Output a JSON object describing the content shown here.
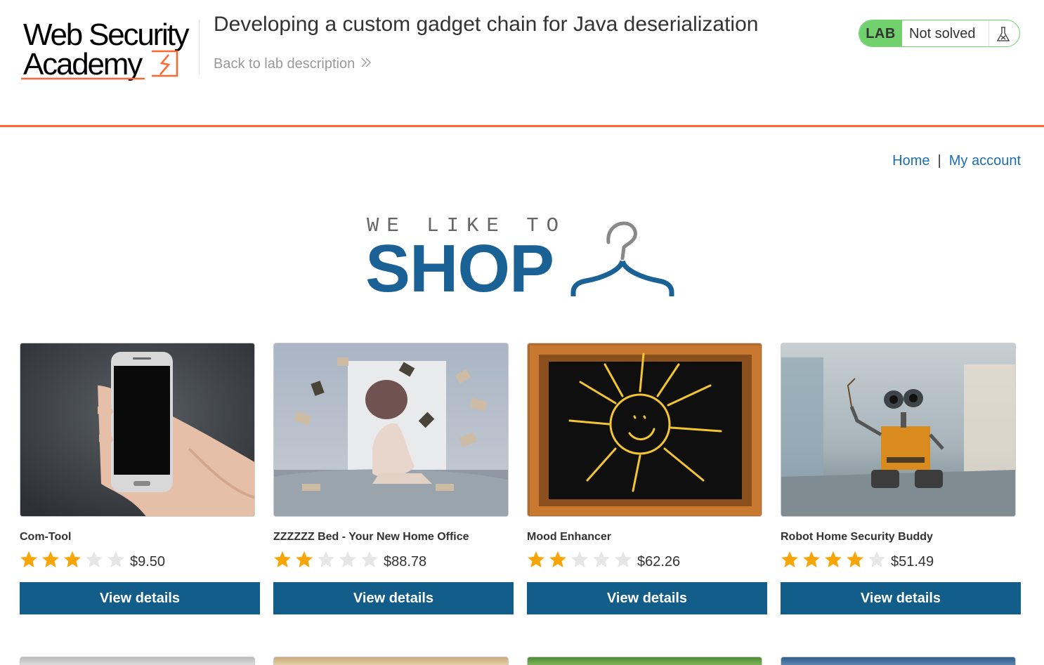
{
  "academy": {
    "logo_line1": "Web Security",
    "logo_line2": "Academy",
    "lab_title": "Developing a custom gadget chain for Java deserialization",
    "back_link": "Back to lab description",
    "lab_badge": "LAB",
    "lab_status": "Not solved",
    "accent_color": "#ff6633",
    "badge_color": "#70d16d"
  },
  "nav": {
    "home": "Home",
    "separator": "|",
    "my_account": "My account"
  },
  "banner": {
    "tagline": "WE LIKE TO",
    "headline": "SHOP"
  },
  "products": [
    {
      "name": "Com-Tool",
      "rating": 3,
      "price": "$9.50",
      "button": "View details",
      "image": "hand-holding-phone"
    },
    {
      "name": "ZZZZZZ Bed - Your New Home Office",
      "rating": 2,
      "price": "$88.78",
      "button": "View details",
      "image": "woman-on-bed-with-flying-books"
    },
    {
      "name": "Mood Enhancer",
      "rating": 2,
      "price": "$62.26",
      "button": "View details",
      "image": "chalkboard-sun-drawing"
    },
    {
      "name": "Robot Home Security Buddy",
      "rating": 4,
      "price": "$51.49",
      "button": "View details",
      "image": "toy-robot"
    }
  ],
  "colors": {
    "link": "#1c6fb5",
    "button": "#125d8a",
    "star_filled": "#f6a609",
    "star_empty": "#e6e6e6",
    "brand_blue": "#1a6196"
  }
}
